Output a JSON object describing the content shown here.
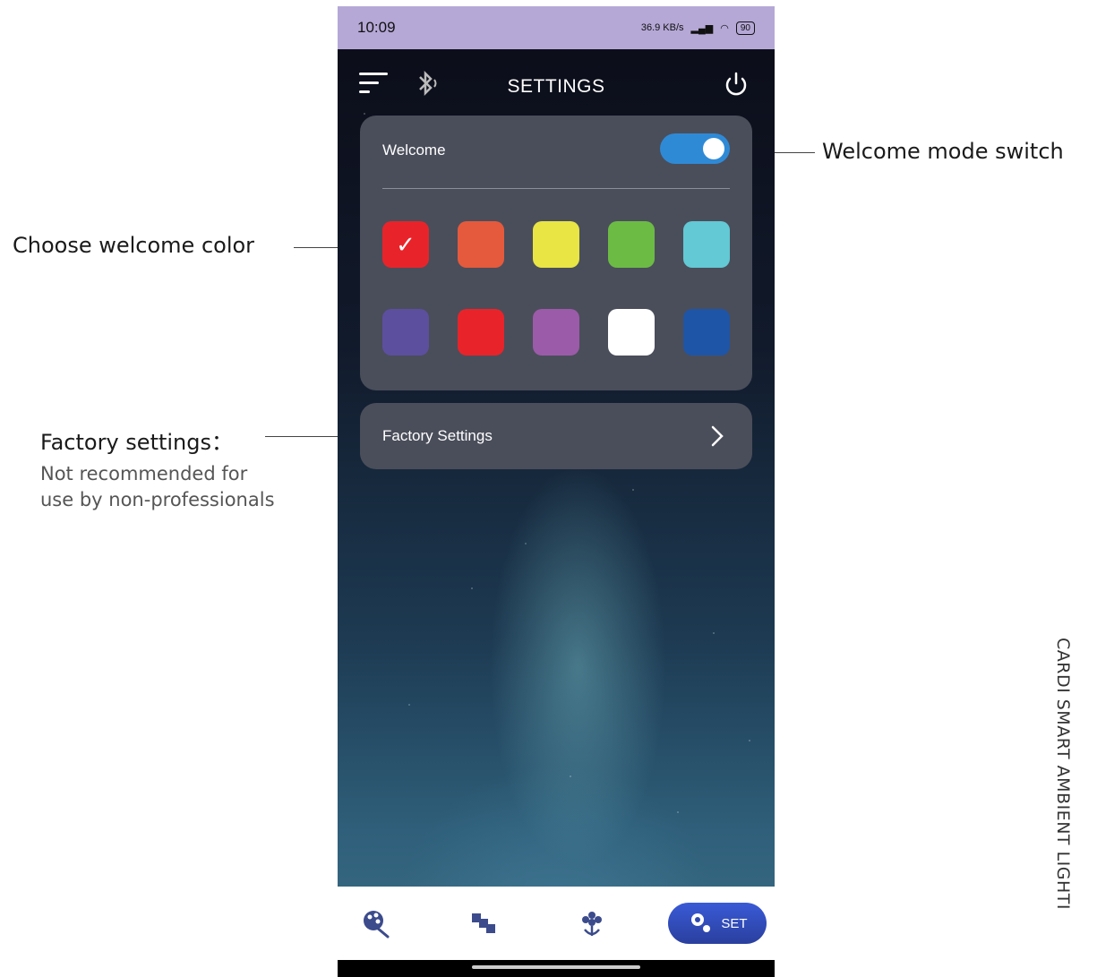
{
  "annotations": {
    "welcome_switch": "Welcome mode switch",
    "choose_color": "Choose welcome color",
    "factory_title": "Factory settings：",
    "factory_note_1": "Not recommended for",
    "factory_note_2": "use by non-professionals",
    "brand_vertical": "CARDI SMART AMBIENT LIGHTI"
  },
  "statusbar": {
    "time": "10:09",
    "net_speed": "36.9 KB/s",
    "battery": "90"
  },
  "header": {
    "title": "SETTINGS",
    "menu_icon": "menu-icon",
    "bluetooth_icon": "bluetooth-icon",
    "power_icon": "power-icon"
  },
  "welcome": {
    "label": "Welcome",
    "enabled": true,
    "toggle_color": "#2f8ad6",
    "selected_index": 0,
    "colors": [
      "#e8242a",
      "#e55a3c",
      "#e8e545",
      "#6cbb45",
      "#62c9d5",
      "#5c4f9e",
      "#e8242a",
      "#9b5ba8",
      "#ffffff",
      "#1f55a7"
    ]
  },
  "factory": {
    "label": "Factory Settings"
  },
  "bottomnav": {
    "items": [
      "palette-icon",
      "blocks-icon",
      "flower-icon"
    ],
    "active_label": "SET",
    "active_icon": "gear-icon"
  }
}
